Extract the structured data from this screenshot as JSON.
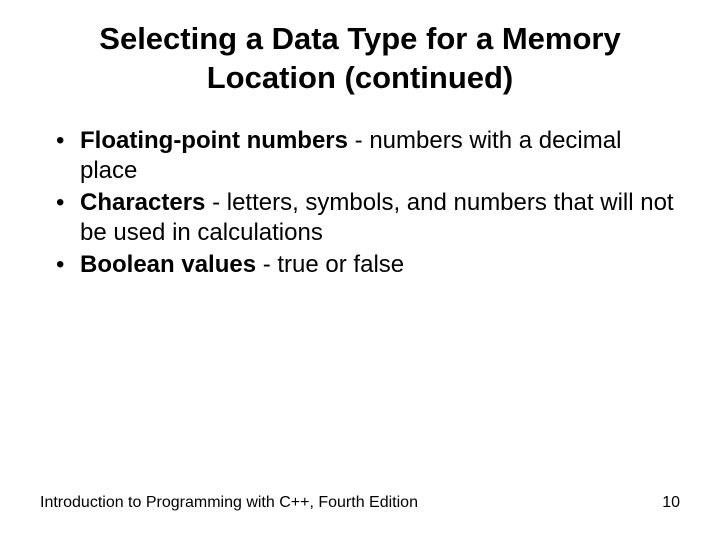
{
  "title": "Selecting a Data Type for a Memory Location (continued)",
  "bullets": [
    {
      "term": "Floating-point numbers",
      "desc": " - numbers with a decimal place"
    },
    {
      "term": "Characters",
      "desc": " - letters, symbols, and numbers that will not be used in calculations"
    },
    {
      "term": "Boolean values",
      "desc": " - true or false"
    }
  ],
  "footer": {
    "left": "Introduction to Programming with C++, Fourth Edition",
    "right": "10"
  }
}
